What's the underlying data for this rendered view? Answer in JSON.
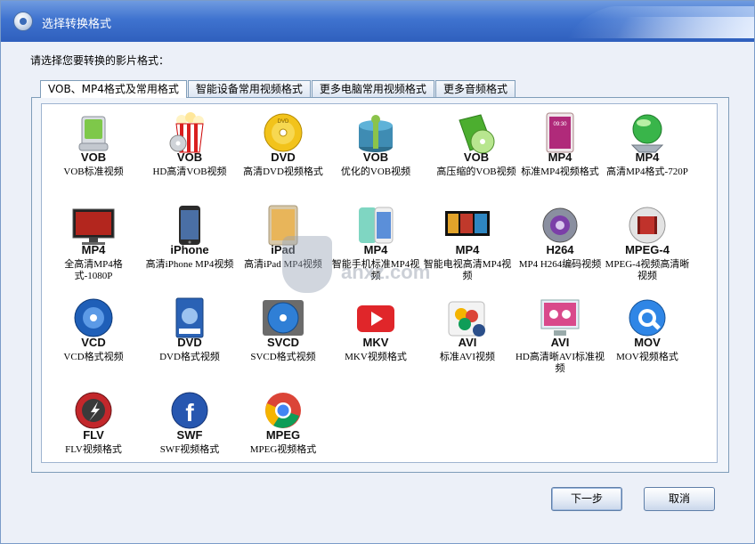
{
  "window": {
    "title": "选择转换格式",
    "prompt": "请选择您要转换的影片格式："
  },
  "tabs": [
    {
      "label": "VOB、MP4格式及常用格式",
      "active": true
    },
    {
      "label": "智能设备常用视频格式",
      "active": false
    },
    {
      "label": "更多电脑常用视频格式",
      "active": false
    },
    {
      "label": "更多音频格式",
      "active": false
    }
  ],
  "formats": [
    {
      "format": "VOB",
      "desc": "VOB标准视频",
      "icon": "usb-drive-icon"
    },
    {
      "format": "VOB",
      "desc": "HD高清VOB视频",
      "icon": "popcorn-icon"
    },
    {
      "format": "DVD",
      "desc": "高清DVD视频格式",
      "icon": "dvd-disc-icon"
    },
    {
      "format": "VOB",
      "desc": "优化的VOB视频",
      "icon": "gift-box-icon"
    },
    {
      "format": "VOB",
      "desc": "高压缩的VOB视频",
      "icon": "green-disc-icon"
    },
    {
      "format": "MP4",
      "desc": "标准MP4视频格式",
      "icon": "tablet-icon"
    },
    {
      "format": "MP4",
      "desc": "高清MP4格式-720P",
      "icon": "green-orb-icon"
    },
    {
      "format": "MP4",
      "desc": "全高清MP4格式-1080P",
      "icon": "monitor-icon"
    },
    {
      "format": "iPhone",
      "desc": "高清iPhone MP4视频",
      "icon": "iphone-icon"
    },
    {
      "format": "iPad",
      "desc": "高清iPad MP4视频",
      "icon": "ipad-icon"
    },
    {
      "format": "MP4",
      "desc": "智能手机标准MP4视频",
      "icon": "smartphone-icon"
    },
    {
      "format": "MP4",
      "desc": "智能电视高清MP4视频",
      "icon": "smart-tv-icon"
    },
    {
      "format": "H264",
      "desc": "MP4 H264编码视频",
      "icon": "h264-orb-icon"
    },
    {
      "format": "MPEG-4",
      "desc": "MPEG-4视频高清晰视频",
      "icon": "film-orb-icon"
    },
    {
      "format": "VCD",
      "desc": "VCD格式视频",
      "icon": "vcd-disc-icon"
    },
    {
      "format": "DVD",
      "desc": "DVD格式视频",
      "icon": "dvd-case-icon"
    },
    {
      "format": "SVCD",
      "desc": "SVCD格式视频",
      "icon": "svcd-disc-icon"
    },
    {
      "format": "MKV",
      "desc": "MKV视频格式",
      "icon": "play-button-icon"
    },
    {
      "format": "AVI",
      "desc": "标准AVI视频",
      "icon": "photos-icon"
    },
    {
      "format": "AVI",
      "desc": "HD高清晰AVI标准视频",
      "icon": "screen-icon"
    },
    {
      "format": "MOV",
      "desc": "MOV视频格式",
      "icon": "quicktime-icon"
    },
    {
      "format": "FLV",
      "desc": "FLV视频格式",
      "icon": "flash-icon"
    },
    {
      "format": "SWF",
      "desc": "SWF视频格式",
      "icon": "facebook-orb-icon"
    },
    {
      "format": "MPEG",
      "desc": "MPEG视频格式",
      "icon": "chrome-icon"
    }
  ],
  "watermark": {
    "text": "anxz.com"
  },
  "buttons": {
    "next": "下一步",
    "cancel": "取消"
  },
  "colors": {
    "titlebar": "#3f73cf",
    "panel_border": "#7f9db9"
  }
}
